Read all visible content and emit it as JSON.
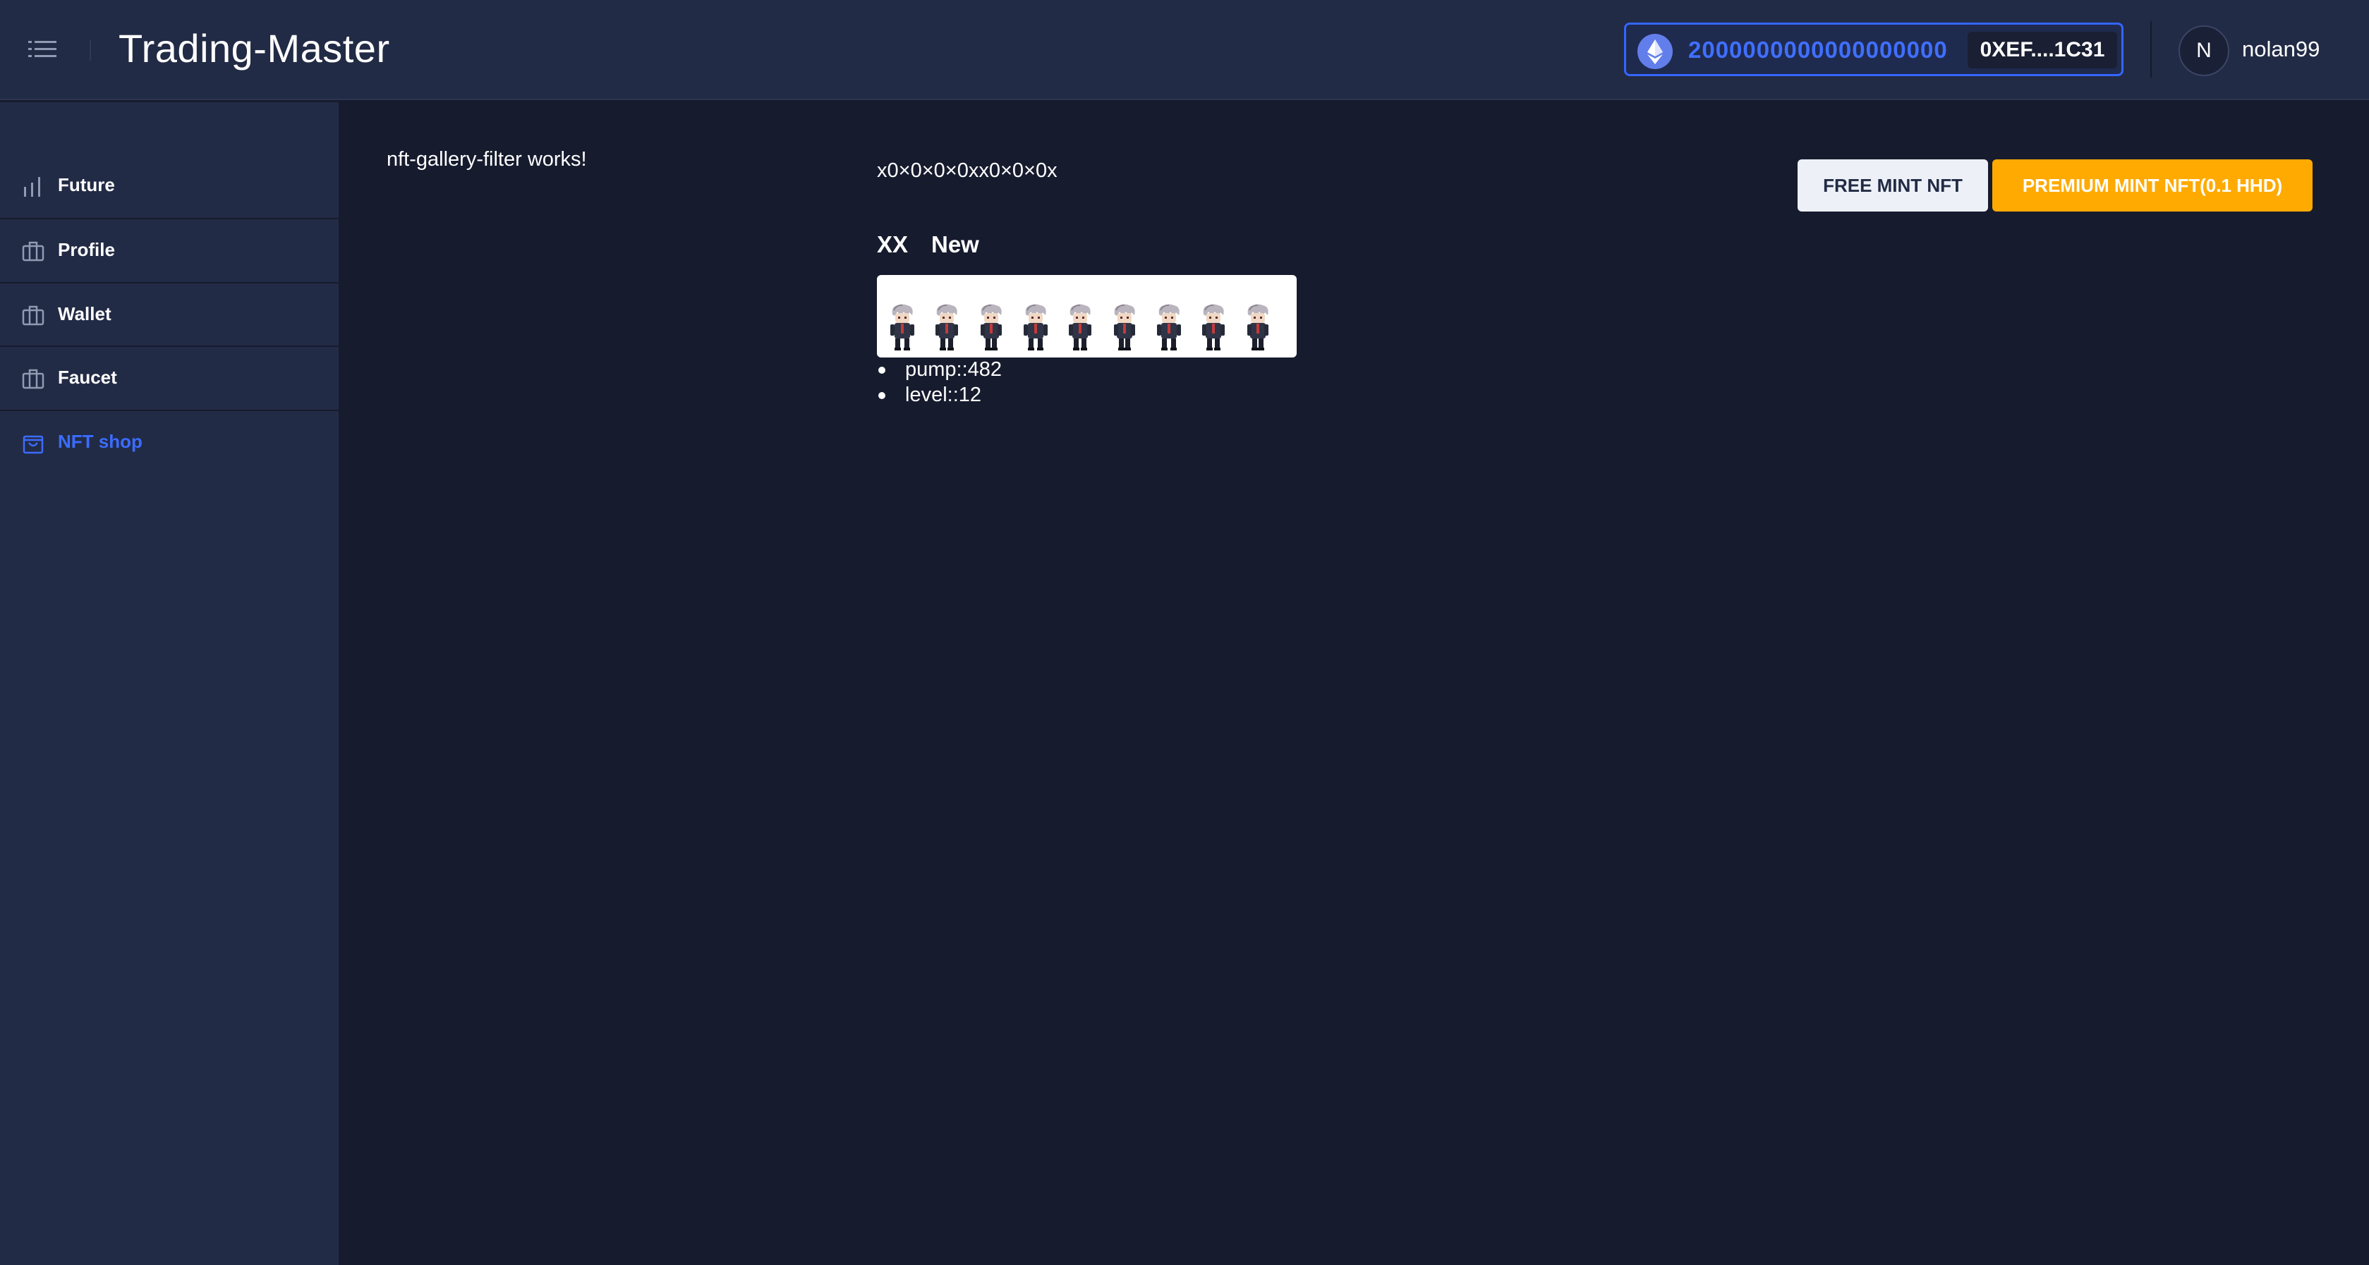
{
  "header": {
    "title": "Trading-Master",
    "menu_icon": "hamburger-menu-icon",
    "wallet": {
      "currency_icon": "ethereum-icon",
      "balance": "2000000000000000000",
      "address": "0XEF....1C31"
    },
    "user": {
      "avatar_initial": "N",
      "username": "nolan99"
    }
  },
  "sidebar": {
    "items": [
      {
        "label": "Future",
        "icon": "bar-chart-icon",
        "active": false
      },
      {
        "label": "Profile",
        "icon": "briefcase-icon",
        "active": false
      },
      {
        "label": "Wallet",
        "icon": "briefcase-icon",
        "active": false
      },
      {
        "label": "Faucet",
        "icon": "briefcase-icon",
        "active": false
      },
      {
        "label": "NFT shop",
        "icon": "shopping-bag-icon",
        "active": true
      }
    ]
  },
  "main": {
    "status_text": "nft-gallery-filter works!",
    "hex_text": "x0×0×0×0xx0×0×0x",
    "buttons": {
      "free_mint": "FREE MINT NFT",
      "premium_mint": "PREMIUM MINT NFT(0.1 HHD)"
    },
    "tabs": [
      {
        "label": "XX"
      },
      {
        "label": "New"
      }
    ],
    "nft": {
      "sprite_count": 9,
      "attributes": [
        "pump::482",
        "level::12"
      ]
    }
  },
  "colors": {
    "accent": "#3366ff",
    "premium": "#ffaa00",
    "header_bg": "#222b45",
    "page_bg": "#161b2e"
  }
}
